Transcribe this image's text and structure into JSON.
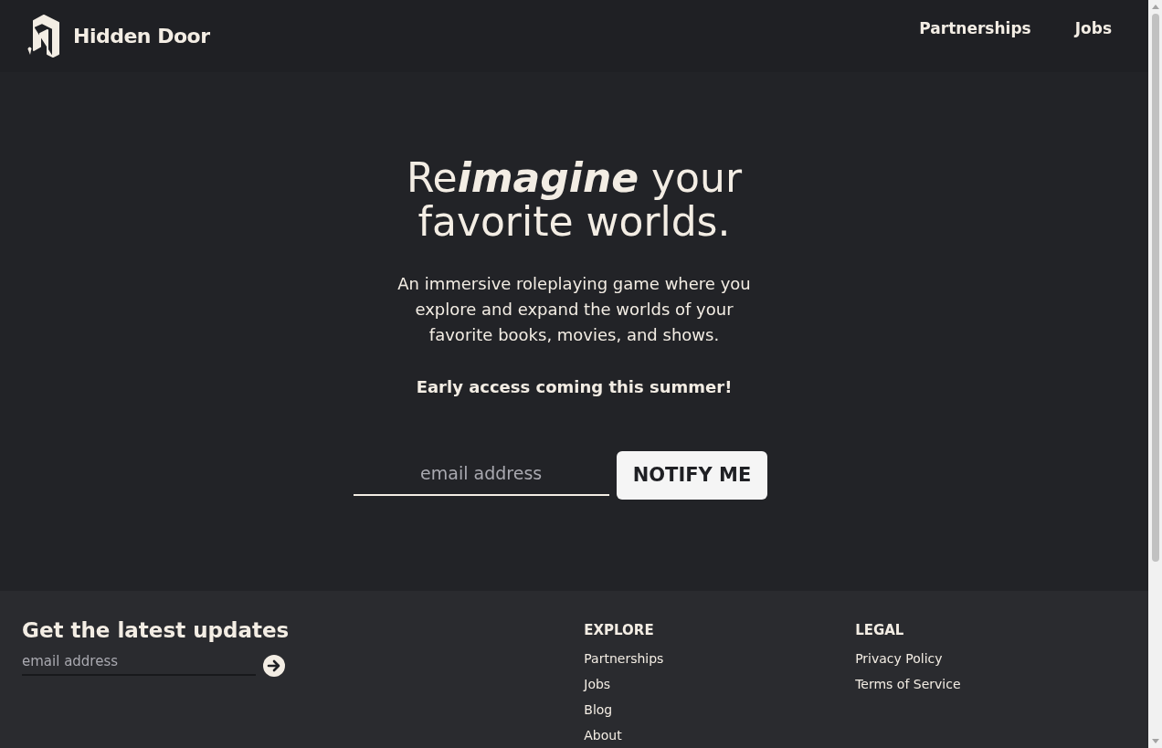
{
  "header": {
    "brand": "Hidden Door",
    "nav": [
      "Partnerships",
      "Jobs"
    ]
  },
  "hero": {
    "headline": "Re**imagine** your\nfavorite worlds.",
    "description": "An immersive roleplaying game where you explore and expand the worlds of your favorite books, movies, and shows.",
    "announcement": "Early access coming this summer!",
    "email": {
      "placeholder": "email address"
    },
    "button": "NOTIFY ME"
  },
  "footer": {
    "signup": {
      "title": "Get the latest updates",
      "email": {
        "placeholder": "email address"
      }
    },
    "columns": [
      {
        "heading": "EXPLORE",
        "links": [
          "Partnerships",
          "Jobs",
          "Blog",
          "About"
        ]
      },
      {
        "heading": "LEGAL",
        "links": [
          "Privacy Policy",
          "Terms of Service"
        ]
      }
    ]
  }
}
